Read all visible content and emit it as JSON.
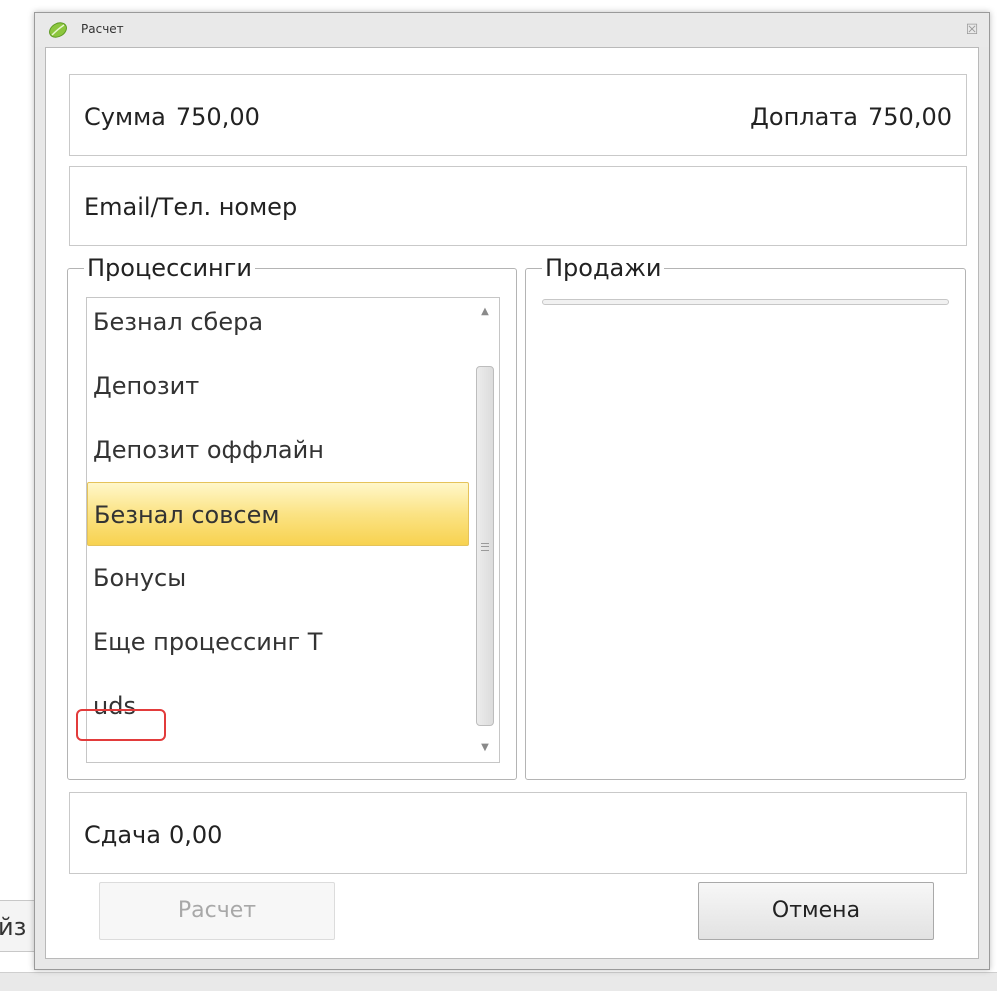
{
  "background": {
    "left_fragment": "йз"
  },
  "window": {
    "title": "Расчет",
    "close_symbol": "☒"
  },
  "summary": {
    "sum_label": "Сумма",
    "sum_value": "750,00",
    "surcharge_label": "Доплата",
    "surcharge_value": "750,00"
  },
  "contact": {
    "label": "Email/Тел. номер"
  },
  "processing": {
    "legend": "Процессинги",
    "items": [
      {
        "label": "Безнал сбера",
        "selected": false
      },
      {
        "label": "Депозит",
        "selected": false
      },
      {
        "label": "Депозит оффлайн",
        "selected": false
      },
      {
        "label": "Безнал совсем",
        "selected": true
      },
      {
        "label": "Бонусы",
        "selected": false
      },
      {
        "label": "Еще процессинг Т",
        "selected": false
      },
      {
        "label": "uds",
        "selected": false,
        "highlighted": true
      }
    ],
    "scroll_up": "▲",
    "scroll_down": "▼"
  },
  "sales": {
    "legend": "Продажи"
  },
  "change": {
    "label": "Сдача",
    "value": "0,00"
  },
  "buttons": {
    "calculate": "Расчет",
    "cancel": "Отмена"
  },
  "colors": {
    "selection": "#fbe384",
    "highlight": "#e23b3b"
  }
}
